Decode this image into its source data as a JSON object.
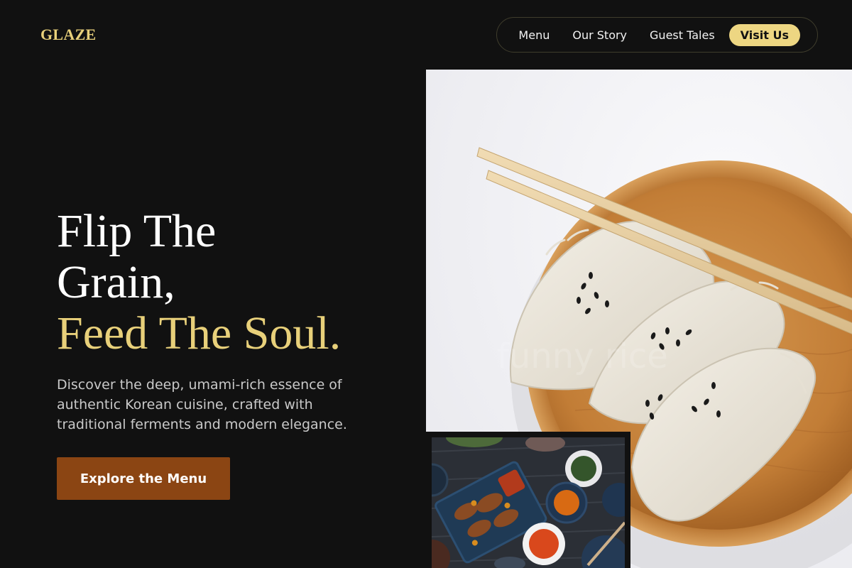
{
  "brand": {
    "logo": "GLAZE"
  },
  "nav": {
    "links": [
      "Menu",
      "Our Story",
      "Guest Tales"
    ],
    "cta": "Visit Us"
  },
  "hero": {
    "title_line1": "Flip The",
    "title_line2": "Grain,",
    "title_line3": "Feed The Soul.",
    "description": "Discover the deep, umami-rich essence of authentic Korean cuisine, crafted with traditional ferments and modern elegance.",
    "cta_label": "Explore the Menu"
  },
  "images": {
    "main_watermark": "funny rice",
    "main_subject": "dumplings-on-wooden-plate-with-chopsticks",
    "inset_subject": "korean-banchan-spread"
  },
  "colors": {
    "background": "#111111",
    "accent_gold": "#E8D07A",
    "cta_pill": "#EDD682",
    "button_brown": "#8B4513"
  }
}
